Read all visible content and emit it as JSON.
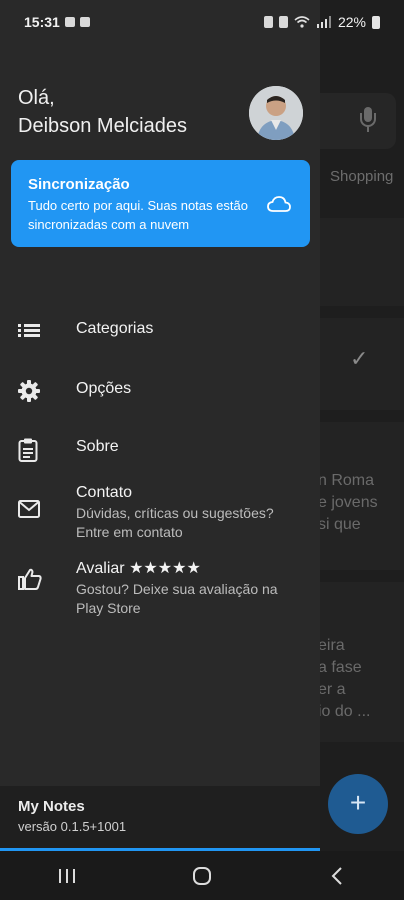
{
  "status_bar": {
    "time": "15:31",
    "battery": "22%"
  },
  "drawer": {
    "greeting_line1": "Olá,",
    "greeting_line2": "Deibson Melciades",
    "sync": {
      "title": "Sincronização",
      "text": "Tudo certo por aqui. Suas notas estão sincronizadas com a nuvem",
      "icon": "cloud-icon"
    },
    "menu": [
      {
        "label": "Categorias",
        "icon": "list-icon"
      },
      {
        "label": "Opções",
        "icon": "gear-icon"
      },
      {
        "label": "Sobre",
        "icon": "clipboard-icon"
      },
      {
        "label": "Contato",
        "subtitle": "Dúvidas, críticas ou sugestões? Entre em contato",
        "icon": "mail-icon"
      },
      {
        "label": "Avaliar ★★★★★",
        "subtitle": "Gostou? Deixe sua avaliação na Play Store",
        "icon": "thumbs-up-icon"
      }
    ],
    "footer": {
      "app_name": "My Notes",
      "version": "versão 0.1.5+1001"
    }
  },
  "background": {
    "chip_shopping": "Shopping",
    "snippet_1": [
      "n Roma",
      "e jovens",
      "si que"
    ],
    "snippet_2": [
      "eira",
      "a fase",
      "er a",
      "io do ..."
    ],
    "fab_label": "+"
  },
  "colors": {
    "accent": "#2196f3",
    "drawer_bg": "#292929",
    "fab": "#1f5b92"
  }
}
